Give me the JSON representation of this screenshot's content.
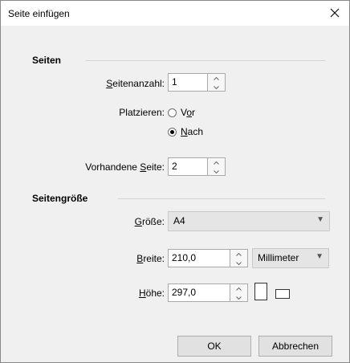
{
  "dialog": {
    "title": "Seite einfügen",
    "close_glyph": "✕"
  },
  "pages_section": {
    "title": "Seiten",
    "count_label_mnemonic": "S",
    "count_label_rest": "eitenanzahl:",
    "count_value": "1",
    "place_label": "Platzieren:",
    "before_label_pre": "V",
    "before_label_mnemonic": "o",
    "before_label_post": "r",
    "after_label_mnemonic": "N",
    "after_label_rest": "ach",
    "selected_position": "after",
    "existing_label_pre": "Vorhandene ",
    "existing_label_mnemonic": "S",
    "existing_label_post": "eite:",
    "existing_value": "2"
  },
  "size_section": {
    "title": "Seitengröße",
    "size_label_mnemonic": "G",
    "size_label_rest": "röße:",
    "size_value": "A4",
    "width_label_mnemonic": "B",
    "width_label_rest": "reite:",
    "width_value": "210,0",
    "unit_value": "Millimeter",
    "height_label_mnemonic": "H",
    "height_label_rest": "öhe:",
    "height_value": "297,0",
    "orientation": "portrait"
  },
  "buttons": {
    "ok": "OK",
    "cancel": "Abbrechen"
  },
  "icons": {
    "close": "close-icon",
    "spin_up": "chevron-up-icon",
    "spin_down": "chevron-down-icon",
    "dropdown": "chevron-down-icon",
    "portrait": "portrait-orientation-icon",
    "landscape": "landscape-orientation-icon"
  }
}
